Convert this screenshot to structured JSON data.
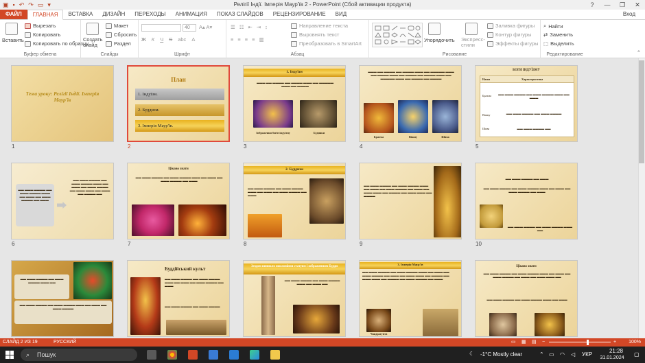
{
  "window": {
    "title": "Релігії Індії. Імперія Маур'їв 2 - PowerPoint (Сбой активации продукта)",
    "controls": [
      "?",
      "—",
      "❐",
      "✕"
    ]
  },
  "tabs": {
    "file": "ФАЙЛ",
    "items": [
      "ГЛАВНАЯ",
      "ВСТАВКА",
      "ДИЗАЙН",
      "ПЕРЕХОДЫ",
      "АНИМАЦИЯ",
      "ПОКАЗ СЛАЙДОВ",
      "РЕЦЕНЗИРОВАНИЕ",
      "ВИД"
    ],
    "active": "ГЛАВНАЯ",
    "login": "Вход"
  },
  "ribbon": {
    "clipboard": {
      "label": "Буфер обмена",
      "paste": "Вставить",
      "cut": "Вырезать",
      "copy": "Копировать",
      "format_painter": "Копировать по образцу"
    },
    "slides": {
      "label": "Слайды",
      "new_slide": "Создать слайд",
      "layout": "Макет",
      "reset": "Сбросить",
      "section": "Раздел"
    },
    "font": {
      "label": "Шрифт",
      "font_name": "",
      "font_size": "40",
      "bold": "Ж",
      "italic": "К",
      "underline": "Ч",
      "strike": "S",
      "shadow": "abc"
    },
    "paragraph": {
      "label": "Абзац",
      "text_direction": "Направление текста",
      "align_text": "Выровнять текст",
      "smartart": "Преобразовать в SmartArt"
    },
    "drawing": {
      "label": "Рисование",
      "arrange": "Упорядочить",
      "quick_styles": "Экспресс-стили",
      "shape_fill": "Заливка фигуры",
      "shape_outline": "Контур фигуры",
      "shape_effects": "Эффекты фигуры"
    },
    "editing": {
      "label": "Редактирование",
      "find": "Найти",
      "replace": "Заменить",
      "select": "Выделить"
    }
  },
  "slides": [
    {
      "num": "1",
      "title": "Тема уроку: Релігії Індії. Імперія Маур'їв"
    },
    {
      "num": "2",
      "title": "План",
      "items": [
        "1. Індуїзм.",
        "2. Буддизм.",
        "3. Імперія Маур'їв."
      ]
    },
    {
      "num": "3",
      "title": "1. Індуїзм",
      "caption_left": "Зображення богів індуїзму",
      "caption_right": "Будинки"
    },
    {
      "num": "4",
      "captions": [
        "Брахма",
        "Вішну",
        "Шива"
      ]
    },
    {
      "num": "5",
      "title": "БОГИ ІНДУЇЗМУ",
      "table_header": [
        "Назва",
        "Характеристика"
      ],
      "rows": [
        "Брахма",
        "Вішну",
        "Шива"
      ]
    },
    {
      "num": "6"
    },
    {
      "num": "7",
      "title": "Цікаво знати"
    },
    {
      "num": "8",
      "title": "2. Буддизм"
    },
    {
      "num": "9"
    },
    {
      "num": "10"
    },
    {
      "num": "",
      "title": ""
    },
    {
      "num": "",
      "title": "Буддійський культ"
    },
    {
      "num": "",
      "title": "Згодом виникло поклоніння статуям і зображенням Будди"
    },
    {
      "num": "",
      "title": "3. Імперія Маур'їв",
      "caption": "Чандрагупта"
    },
    {
      "num": "",
      "title": "Цікаво знати"
    }
  ],
  "status": {
    "slide_info": "СЛАЙД 2 ИЗ 19",
    "language": "РУССКИЙ",
    "zoom": "100%",
    "zoom_level": 0.62
  },
  "taskbar": {
    "search_placeholder": "Пошук",
    "weather": "-1°C  Mostly clear",
    "language": "УКР",
    "time": "21:28",
    "date": "31.01.2024"
  },
  "colors": {
    "accent": "#d24726",
    "slide_bg": "#f1e2b8",
    "gold": "#e9b320"
  }
}
